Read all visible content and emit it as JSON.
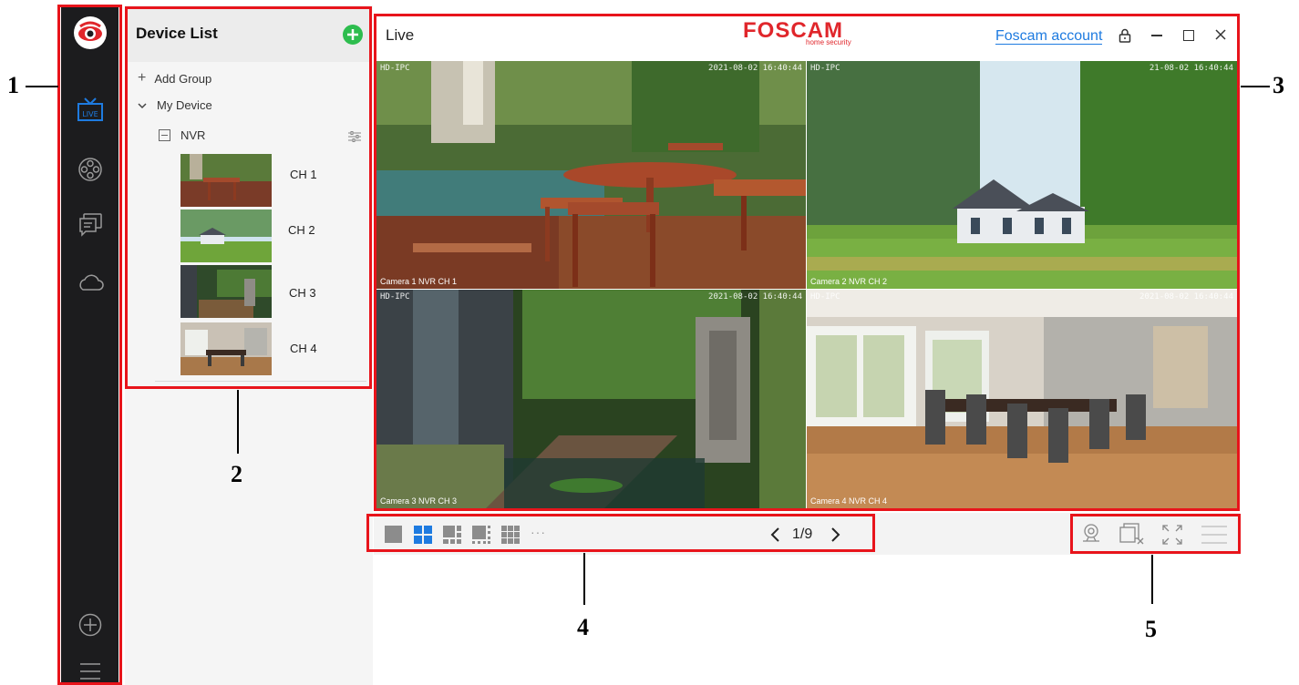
{
  "sidebar": {
    "items": [
      {
        "icon": "app-logo-icon"
      },
      {
        "icon": "live-tv-icon",
        "label": "LIVE"
      },
      {
        "icon": "playback-reel-icon"
      },
      {
        "icon": "message-icon"
      },
      {
        "icon": "cloud-icon"
      },
      {
        "icon": "add-circle-icon"
      },
      {
        "icon": "menu-icon"
      }
    ]
  },
  "device_list": {
    "title": "Device List",
    "add_group": "Add Group",
    "my_device": "My Device",
    "device_name": "NVR",
    "channels": [
      "CH 1",
      "CH 2",
      "CH 3",
      "CH 4"
    ]
  },
  "live": {
    "title": "Live",
    "brand": "FOSCAM",
    "brand_tagline": "home security",
    "account_link": "Foscam account",
    "cameras": [
      {
        "top_left": "HD-IPC",
        "timestamp": "2021-08-02 16:40:44",
        "caption": "Camera 1 NVR  CH 1"
      },
      {
        "top_left": "HD-IPC",
        "timestamp": "21-08-02 16:40:44",
        "caption": "Camera 2 NVR  CH 2"
      },
      {
        "top_left": "HD-IPC",
        "timestamp": "2021-08-02 16:40:44",
        "caption": "Camera 3 NVR  CH 3"
      },
      {
        "top_left": "HD-IPC",
        "timestamp": "2021-08-02 16:40:44",
        "caption": "Camera 4 NVR  CH 4"
      }
    ]
  },
  "toolbar": {
    "layouts": [
      "layout-1-icon",
      "layout-4-icon",
      "layout-6-icon",
      "layout-8-icon",
      "layout-9-icon"
    ],
    "more": "···",
    "page_indicator": "1/9"
  },
  "annotations": [
    "1",
    "2",
    "3",
    "4",
    "5"
  ],
  "colors": {
    "accent_blue": "#1e7be0",
    "annotation_red": "#e8141b",
    "brand_red": "#e0262b",
    "add_green": "#2dbd4e",
    "nav_bg": "#1c1c1e"
  }
}
